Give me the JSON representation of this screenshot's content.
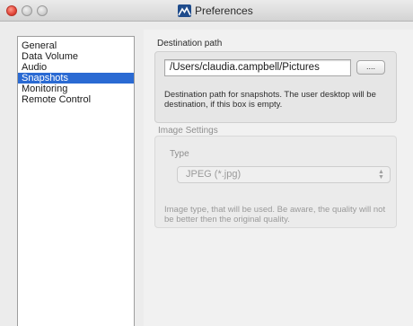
{
  "window": {
    "title": "Preferences"
  },
  "sidebar": {
    "items": [
      {
        "label": "General"
      },
      {
        "label": "Data Volume"
      },
      {
        "label": "Audio"
      },
      {
        "label": "Snapshots"
      },
      {
        "label": "Monitoring"
      },
      {
        "label": "Remote Control"
      }
    ],
    "selected": "Snapshots"
  },
  "destination": {
    "section_label": "Destination path",
    "path_value": "/Users/claudia.campbell/Pictures",
    "browse_label": "....",
    "help_line1": "Destination path for snapshots. The user desktop will be",
    "help_line2": "destination, if this box is empty."
  },
  "image_settings": {
    "section_label": "Image Settings",
    "type_label": "Type",
    "type_value": "JPEG (*.jpg)",
    "help_line1": "Image type, that will be used. Be aware, the quality will not",
    "help_line2": "be better then the original quality."
  },
  "colors": {
    "selection": "#2a6ad3",
    "close_button": "#e2463a"
  },
  "icons": {
    "app": "mountain-logo-icon",
    "stepper": "updown-arrows-icon"
  }
}
